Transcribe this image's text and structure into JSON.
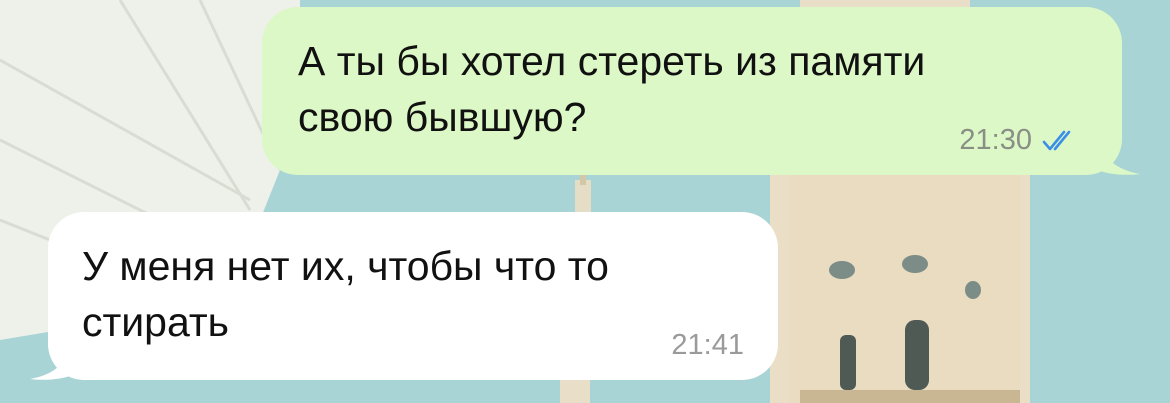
{
  "chat": {
    "messages": [
      {
        "direction": "outgoing",
        "text": "А ты бы хотел стереть из памяти\nсвою бывшую?",
        "time": "21:30",
        "status_icon": "double-check-read-icon",
        "bubble_color": "#dcf8c6"
      },
      {
        "direction": "incoming",
        "text": "У меня нет их, чтобы что то\nстирать",
        "time": "21:41",
        "bubble_color": "#ffffff"
      }
    ]
  },
  "colors": {
    "sky": "#a9d4d6",
    "read_ticks": "#3b8fe8"
  }
}
